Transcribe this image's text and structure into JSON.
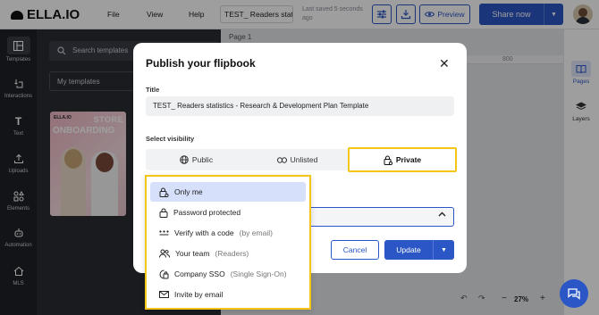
{
  "app": {
    "logo_text": "ELLA.IO",
    "menu": [
      "File",
      "View",
      "Help"
    ],
    "doc_title": "TEST_ Readers statis",
    "saved_status": "Last saved 5 seconds ago",
    "preview_label": "Preview",
    "share_label": "Share now"
  },
  "left_sidebar": {
    "items": [
      {
        "label": "Templates",
        "icon": "templates-icon"
      },
      {
        "label": "Interactions",
        "icon": "interactions-icon"
      },
      {
        "label": "Text",
        "icon": "text-icon"
      },
      {
        "label": "Uploads",
        "icon": "uploads-icon"
      },
      {
        "label": "Elements",
        "icon": "elements-icon"
      },
      {
        "label": "Automation",
        "icon": "automation-icon"
      },
      {
        "label": "MLS",
        "icon": "mls-icon"
      }
    ]
  },
  "panel": {
    "search_placeholder": "Search templates",
    "filter_label": "My templates",
    "thumb": {
      "brand": "ELLA.IO",
      "line1": "STORE",
      "line2": "ONBOARDING"
    }
  },
  "canvas": {
    "page_label": "Page 1",
    "ruler_label": "800",
    "zoom": "27%",
    "zoom_minus": "−",
    "zoom_plus": "+"
  },
  "right_sidebar": {
    "items": [
      {
        "label": "Pages",
        "icon": "pages-icon",
        "active": true
      },
      {
        "label": "Layers",
        "icon": "layers-icon",
        "active": false
      }
    ]
  },
  "modal": {
    "title": "Publish your flipbook",
    "title_label": "Title",
    "title_value": "TEST_ Readers statistics - Research & Development Plan Template",
    "visibility_label": "Select visibility",
    "visibility_options": [
      {
        "label": "Public",
        "icon": "globe-icon"
      },
      {
        "label": "Unlisted",
        "icon": "link-icon"
      },
      {
        "label": "Private",
        "icon": "lock-icon",
        "selected": true
      }
    ],
    "cancel_label": "Cancel",
    "update_label": "Update"
  },
  "dropdown": {
    "items": [
      {
        "label": "Only me",
        "hint": "",
        "icon": "lock-person-icon",
        "selected": true
      },
      {
        "label": "Password protected",
        "hint": "",
        "icon": "padlock-icon"
      },
      {
        "label": "Verify with a code",
        "hint": "(by email)",
        "icon": "code-dots-icon"
      },
      {
        "label": "Your team",
        "hint": "(Readers)",
        "icon": "team-icon"
      },
      {
        "label": "Company SSO",
        "hint": "(Single Sign-On)",
        "icon": "sso-icon"
      },
      {
        "label": "Invite by email",
        "hint": "",
        "icon": "envelope-icon"
      }
    ]
  },
  "colors": {
    "accent": "#2a56c6",
    "highlight": "#f5c518",
    "selected_bg": "#d6e0fb"
  }
}
